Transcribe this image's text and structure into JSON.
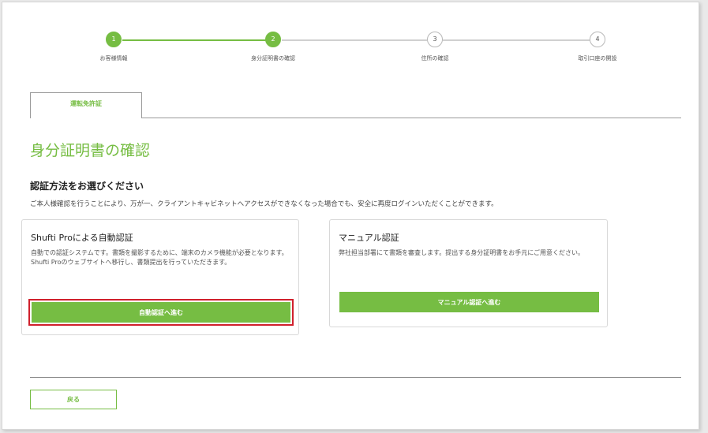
{
  "stepper": {
    "steps": [
      {
        "number": "1",
        "label": "お客様情報",
        "state": "done"
      },
      {
        "number": "2",
        "label": "身分証明書の確認",
        "state": "current"
      },
      {
        "number": "3",
        "label": "住所の確認",
        "state": "pending"
      },
      {
        "number": "4",
        "label": "取引口座の開設",
        "state": "pending"
      }
    ]
  },
  "tab": {
    "label": "運転免許証"
  },
  "page": {
    "title": "身分証明書の確認"
  },
  "section": {
    "heading": "認証方法をお選びください",
    "description": "ご本人様確認を行うことにより、万が一、クライアントキャビネットへアクセスができなくなった場合でも、安全に再度ログインいただくことができます。"
  },
  "cards": {
    "auto": {
      "title": "Shufti Proによる自動認証",
      "description": "自動での認証システムです。書類を撮影するために、端末のカメラ機能が必要となります。Shufti Proのウェブサイトへ移行し、書類提出を行っていただきます。",
      "button": "自動認証へ進む"
    },
    "manual": {
      "title": "マニュアル認証",
      "description": "弊社担当部署にて書類を審査します。提出する身分証明書をお手元にご用意ください。",
      "button": "マニュアル認証へ進む"
    }
  },
  "footer": {
    "back_button": "戻る"
  },
  "colors": {
    "accent": "#76bd43",
    "highlight": "#d0202c"
  }
}
